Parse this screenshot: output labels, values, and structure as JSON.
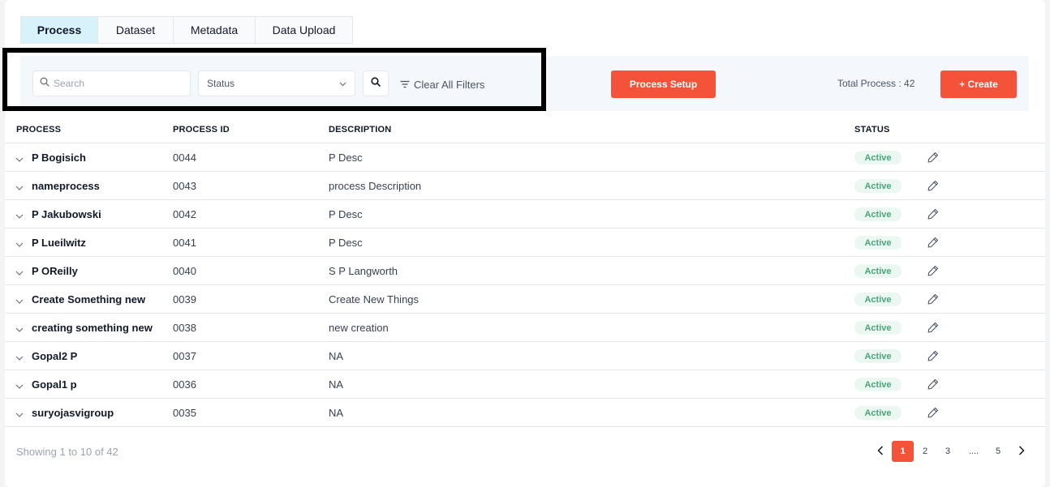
{
  "tabs": [
    "Process",
    "Dataset",
    "Metadata",
    "Data Upload"
  ],
  "filters": {
    "search_placeholder": "Search",
    "status_placeholder": "Status",
    "clear_label": "Clear All Filters"
  },
  "actions": {
    "process_setup_label": "Process Setup",
    "total_label": "Total Process : 42",
    "create_label": "+ Create"
  },
  "table": {
    "headers": [
      "PROCESS",
      "PROCESS ID",
      "DESCRIPTION",
      "STATUS"
    ],
    "rows": [
      {
        "name": "P Bogisich",
        "id": "0044",
        "description": "P Desc",
        "status": "Active"
      },
      {
        "name": "nameprocess",
        "id": "0043",
        "description": "process Description",
        "status": "Active"
      },
      {
        "name": "P Jakubowski",
        "id": "0042",
        "description": "P Desc",
        "status": "Active"
      },
      {
        "name": "P Lueilwitz",
        "id": "0041",
        "description": "P Desc",
        "status": "Active"
      },
      {
        "name": "P OReilly",
        "id": "0040",
        "description": "S P Langworth",
        "status": "Active"
      },
      {
        "name": "Create Something new",
        "id": "0039",
        "description": "Create New Things",
        "status": "Active"
      },
      {
        "name": "creating something new",
        "id": "0038",
        "description": "new creation",
        "status": "Active"
      },
      {
        "name": "Gopal2 P",
        "id": "0037",
        "description": "NA",
        "status": "Active"
      },
      {
        "name": "Gopal1 p",
        "id": "0036",
        "description": "NA",
        "status": "Active"
      },
      {
        "name": "suryojasvigroup",
        "id": "0035",
        "description": "NA",
        "status": "Active"
      }
    ]
  },
  "footer": {
    "showing": "Showing 1 to 10 of 42",
    "pages": [
      "1",
      "2",
      "3",
      "....",
      "5"
    ],
    "current_page": "1"
  },
  "colors": {
    "accent": "#f4533a",
    "active_tab": "#d7f2fb",
    "status_bg": "#ebf7f1",
    "status_text": "#4aa57a"
  }
}
